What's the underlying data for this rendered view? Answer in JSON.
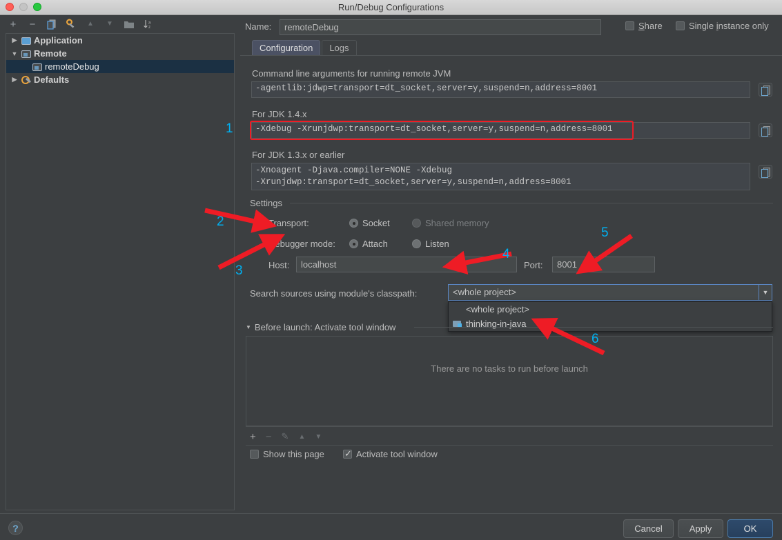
{
  "window": {
    "title": "Run/Debug Configurations",
    "traffic_lights": [
      "close",
      "minimize",
      "zoom"
    ]
  },
  "left_toolbar": {
    "buttons": [
      {
        "name": "add",
        "glyph": "+"
      },
      {
        "name": "remove",
        "glyph": "−"
      },
      {
        "name": "copy",
        "glyph": "❐"
      },
      {
        "name": "edit-defaults",
        "glyph": "⚙"
      },
      {
        "name": "move-up",
        "glyph": "▲"
      },
      {
        "name": "move-down",
        "glyph": "▼"
      },
      {
        "name": "new-folder",
        "glyph": "☰"
      },
      {
        "name": "sort-alphabetically",
        "glyph": "↓"
      }
    ]
  },
  "tree": {
    "items": [
      {
        "label": "Application",
        "expander": "▶",
        "icon": "application-icon",
        "bold": true,
        "selected": false,
        "indent": false
      },
      {
        "label": "Remote",
        "expander": "▼",
        "icon": "remote-icon",
        "bold": true,
        "selected": false,
        "indent": false
      },
      {
        "label": "remoteDebug",
        "expander": "",
        "icon": "remote-icon",
        "bold": false,
        "selected": true,
        "indent": true
      },
      {
        "label": "Defaults",
        "expander": "▶",
        "icon": "wrench-icon",
        "bold": true,
        "selected": false,
        "indent": false
      }
    ]
  },
  "header": {
    "name_label": "Name:",
    "name_value": "remoteDebug",
    "share_label": "Share",
    "share_checked": false,
    "single_instance_label_pre": "Single ",
    "single_instance_label_key": "i",
    "single_instance_label_post": "nstance only",
    "single_instance_checked": false
  },
  "tabs": [
    {
      "label": "Configuration",
      "active": true
    },
    {
      "label": "Logs",
      "active": false
    }
  ],
  "config": {
    "cmdline_label": "Command line arguments for running remote JVM",
    "cmdline_value": "-agentlib:jdwp=transport=dt_socket,server=y,suspend=n,address=8001",
    "jdk14_label": "For JDK 1.4.x",
    "jdk14_value": "-Xdebug -Xrunjdwp:transport=dt_socket,server=y,suspend=n,address=8001",
    "jdk13_label": "For JDK 1.3.x or earlier",
    "jdk13_value": "-Xnoagent -Djava.compiler=NONE -Xdebug\n-Xrunjdwp:transport=dt_socket,server=y,suspend=n,address=8001",
    "settings_label": "Settings",
    "transport_label": "Transport:",
    "transport_options": [
      {
        "label": "Socket",
        "selected": true,
        "disabled": false
      },
      {
        "label": "Shared memory",
        "selected": false,
        "disabled": true
      }
    ],
    "debugger_mode_label": "Debugger mode:",
    "debugger_mode_options": [
      {
        "label": "Attach",
        "selected": true,
        "disabled": false
      },
      {
        "label": "Listen",
        "selected": false,
        "disabled": false
      }
    ],
    "host_label": "Host:",
    "host_value": "localhost",
    "port_label": "Port:",
    "port_value": "8001",
    "classpath_label": "Search sources using module's classpath:",
    "classpath_value": "<whole project>",
    "classpath_options": [
      {
        "label": "<whole project>",
        "icon": null
      },
      {
        "label": "thinking-in-java",
        "icon": "module-icon"
      }
    ]
  },
  "before_launch": {
    "title": "Before launch: Activate tool window",
    "empty_text": "There are no tasks to run before launch",
    "toolbar": [
      {
        "name": "add-task",
        "glyph": "+",
        "enabled": true
      },
      {
        "name": "remove-task",
        "glyph": "−",
        "enabled": false
      },
      {
        "name": "edit-task",
        "glyph": "✎",
        "enabled": false
      },
      {
        "name": "move-task-up",
        "glyph": "▲",
        "enabled": false
      },
      {
        "name": "move-task-down",
        "glyph": "▼",
        "enabled": false
      }
    ],
    "show_page_label": "Show this page",
    "show_page_checked": false,
    "activate_tool_window_label": "Activate tool window",
    "activate_tool_window_checked": true
  },
  "footer": {
    "help_glyph": "?",
    "cancel_label": "Cancel",
    "apply_label": "Apply",
    "ok_label": "OK"
  },
  "annotations": {
    "color": "#00b0f0",
    "arrow_color": "#ee1c25",
    "numbers": [
      "1",
      "2",
      "3",
      "4",
      "5",
      "6"
    ]
  },
  "copy_buttons": [
    {
      "name": "copy-cmdline-button"
    },
    {
      "name": "copy-jdk14-button"
    },
    {
      "name": "copy-jdk13-button"
    }
  ]
}
